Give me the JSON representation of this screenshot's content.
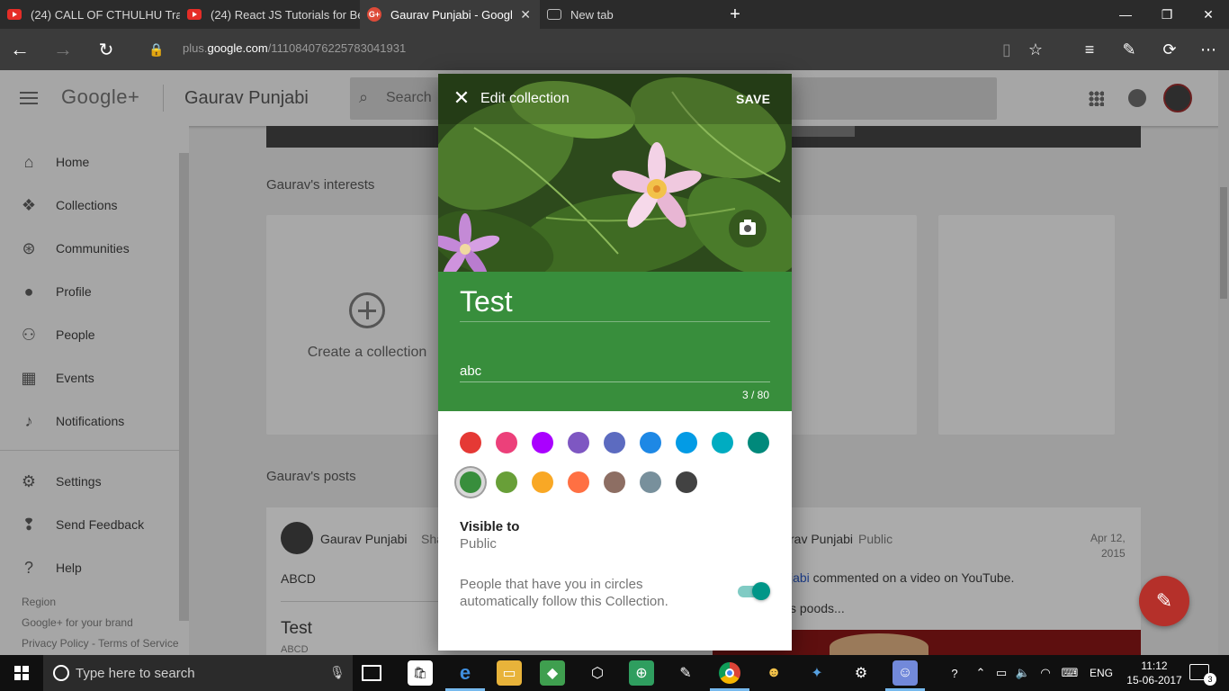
{
  "browser": {
    "tabs": [
      {
        "title": "(24) CALL OF CTHULHU Trai",
        "icon": "youtube-icon"
      },
      {
        "title": "(24) React JS Tutorials for Be",
        "icon": "youtube-icon"
      },
      {
        "title": "Gaurav Punjabi - Googl",
        "icon": "google-plus-icon",
        "active": true
      },
      {
        "title": "New tab",
        "icon": "new-tab-icon"
      }
    ],
    "url_prefix": "plus.",
    "url_domain": "google.com",
    "url_path": "/111084076225783041931"
  },
  "gplus": {
    "logo": "Google+",
    "profile_name": "Gaurav Punjabi",
    "search_placeholder": "Search",
    "sidebar": {
      "items": [
        {
          "label": "Home",
          "icon": "home-icon"
        },
        {
          "label": "Collections",
          "icon": "collections-icon"
        },
        {
          "label": "Communities",
          "icon": "communities-icon"
        },
        {
          "label": "Profile",
          "icon": "profile-icon"
        },
        {
          "label": "People",
          "icon": "people-icon"
        },
        {
          "label": "Events",
          "icon": "events-icon"
        },
        {
          "label": "Notifications",
          "icon": "notifications-icon"
        }
      ],
      "settings": "Settings",
      "feedback": "Send Feedback",
      "help": "Help",
      "footer_region": "Region",
      "footer_brand": "Google+ for your brand",
      "footer_policy": "Privacy Policy - Terms of Service"
    },
    "interests_title": "Gaurav's interests",
    "create_collection": "Create a collection",
    "posts_title": "Gaurav's posts",
    "post1": {
      "author": "Gaurav Punjabi",
      "shared": "Sha",
      "body": "ABCD",
      "sub_title": "Test",
      "sub_body": "ABCD"
    },
    "post2": {
      "author": "rav Punjabi",
      "visibility": "Public",
      "date_line1": "Apr 12,",
      "date_line2": "2015",
      "link_fragment": "jabi",
      "body": " commented on a video on YouTube.",
      "snippet": "s poods..."
    }
  },
  "dialog": {
    "title": "Edit collection",
    "save": "SAVE",
    "collection_title": "Test",
    "description": "abc",
    "char_count": "3 / 80",
    "colors": [
      "#e53935",
      "#ec407a",
      "#aa00ff",
      "#7e57c2",
      "#5c6bc0",
      "#1e88e5",
      "#039be5",
      "#00acc1",
      "#00897b",
      "#388e3c",
      "#689f38",
      "#f9a825",
      "#ff7043",
      "#8d6e63",
      "#78909c",
      "#424242"
    ],
    "selected_color": "#388e3c",
    "visible_to_label": "Visible to",
    "visible_to_value": "Public",
    "follow_text": "People that have you in circles automatically follow this Collection.",
    "follow_enabled": true
  },
  "taskbar": {
    "search_placeholder": "Type here to search",
    "language": "ENG",
    "time": "11:12",
    "date": "15-06-2017",
    "notification_count": "3"
  }
}
